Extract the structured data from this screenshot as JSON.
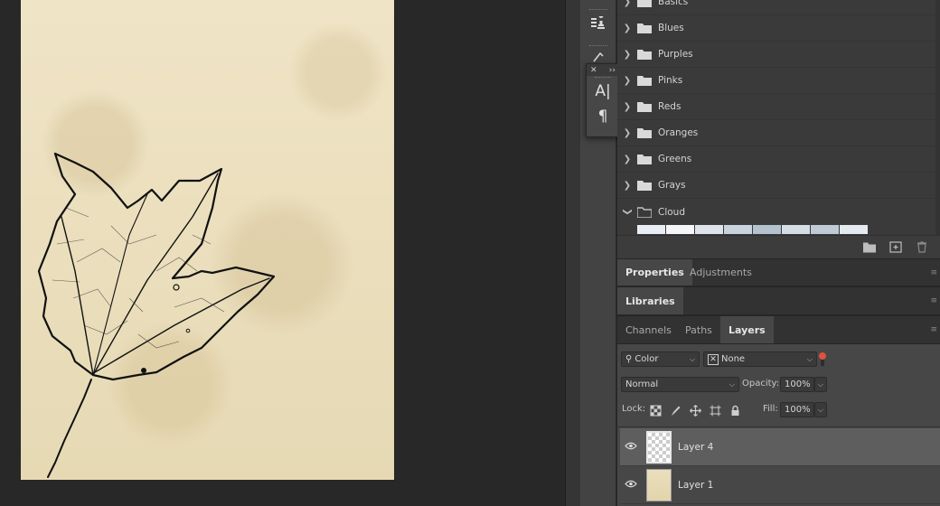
{
  "swatch_folders": [
    {
      "label": "Basics",
      "expanded": false
    },
    {
      "label": "Blues",
      "expanded": false
    },
    {
      "label": "Purples",
      "expanded": false
    },
    {
      "label": "Pinks",
      "expanded": false
    },
    {
      "label": "Reds",
      "expanded": false
    },
    {
      "label": "Oranges",
      "expanded": false
    },
    {
      "label": "Greens",
      "expanded": false
    },
    {
      "label": "Grays",
      "expanded": false
    },
    {
      "label": "Cloud",
      "expanded": true
    }
  ],
  "cloud_swatch_colors": [
    "#e8eef3",
    "#f4f6f8",
    "#dfe4ea",
    "#c9d3dd",
    "#b4c2cf",
    "#d6dde5",
    "#bfcad6",
    "#e4eaef"
  ],
  "panel_tabs": {
    "properties": {
      "label": "Properties",
      "active": true
    },
    "adjustments": {
      "label": "Adjustments",
      "active": false
    },
    "libraries": {
      "label": "Libraries",
      "active": true
    },
    "channels": {
      "label": "Channels",
      "active": false
    },
    "paths": {
      "label": "Paths",
      "active": false
    },
    "layers": {
      "label": "Layers",
      "active": true
    }
  },
  "layers_panel": {
    "filter_kind": "Color",
    "filter_value": "None",
    "blend_mode": "Normal",
    "opacity_label": "Opacity:",
    "opacity_value": "100%",
    "lock_label": "Lock:",
    "fill_label": "Fill:",
    "fill_value": "100%",
    "filter_indicator_color": "#e0513b"
  },
  "layers": [
    {
      "name": "Layer 4",
      "selected": true,
      "visible": true,
      "thumbnail": "transparent"
    },
    {
      "name": "Layer 1",
      "selected": false,
      "visible": true,
      "thumbnail": "parchment"
    }
  ],
  "character_panel": {
    "character_icon": "character-icon",
    "paragraph_icon": "paragraph-icon"
  }
}
